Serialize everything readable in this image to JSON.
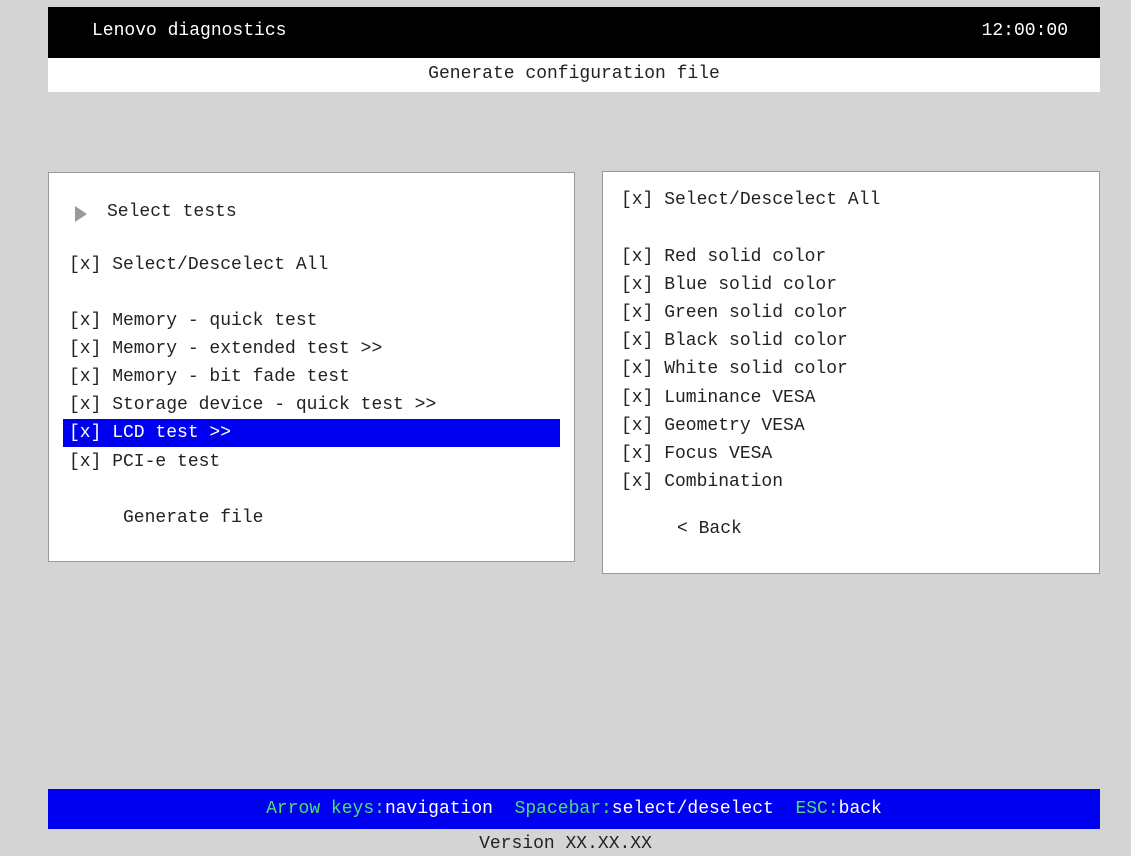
{
  "header": {
    "app_title": "Lenovo diagnostics",
    "clock": "12:00:00"
  },
  "subheader": {
    "title": "Generate configuration file"
  },
  "left_panel": {
    "heading": "Select tests",
    "select_all": "[x] Select/Descelect All",
    "tests": [
      "[x] Memory - quick test",
      "[x] Memory - extended test >>",
      "[x] Memory - bit fade test",
      "[x] Storage device - quick test >>",
      "[x] LCD test >>",
      "[x] PCI-e test"
    ],
    "generate_label": "Generate file"
  },
  "right_panel": {
    "select_all": "[x] Select/Descelect All",
    "subtests": [
      "[x] Red solid color",
      "[x] Blue solid color",
      "[x] Green solid color",
      "[x] Black solid color",
      "[x] White solid color",
      "[x] Luminance VESA",
      "[x] Geometry VESA",
      "[x] Focus VESA",
      "[x] Combination"
    ],
    "back_label": "< Back"
  },
  "footer": {
    "hints": [
      {
        "key": "Arrow keys:",
        "action": "navigation"
      },
      {
        "key": "Spacebar:",
        "action": "select/deselect"
      },
      {
        "key": "ESC:",
        "action": "back"
      }
    ],
    "version": "Version XX.XX.XX"
  },
  "colors": {
    "highlight": "#0000f0",
    "key_text": "#4be07a",
    "background": "#d4d4d4"
  }
}
